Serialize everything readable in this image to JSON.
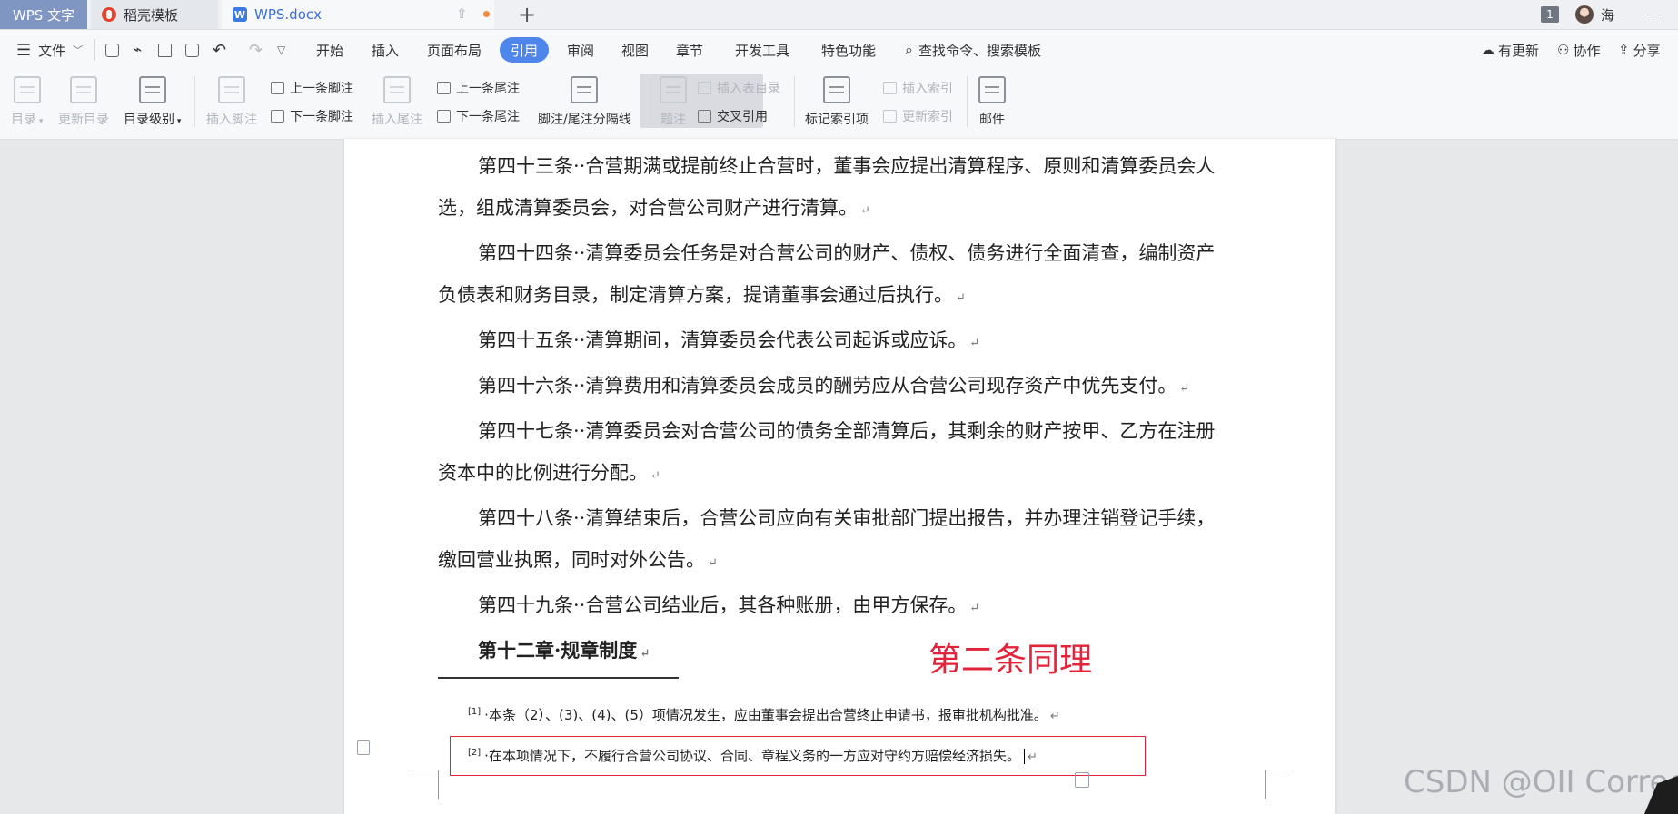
{
  "titlebar": {
    "tabs": [
      {
        "label": "WPS 文字"
      },
      {
        "label": "稻壳模板"
      },
      {
        "label": "WPS.docx"
      }
    ],
    "badge_count": "1",
    "user_name": "海"
  },
  "menubar": {
    "file": "文件",
    "items": [
      "开始",
      "插入",
      "页面布局",
      "引用",
      "审阅",
      "视图",
      "章节",
      "开发工具",
      "特色功能"
    ],
    "active_item": "引用",
    "search": "查找命令、搜索模板",
    "right": [
      "有更新",
      "协作",
      "分享"
    ]
  },
  "ribbon": {
    "toc": "目录",
    "update_toc": "更新目录",
    "toc_level": "目录级别",
    "insert_footnote": "插入脚注",
    "prev_footnote": "上一条脚注",
    "next_footnote": "下一条脚注",
    "insert_endnote": "插入尾注",
    "prev_endnote": "上一条尾注",
    "next_endnote": "下一条尾注",
    "separator": "脚注/尾注分隔线",
    "caption": "题注",
    "insert_table_caption": "插入表目录",
    "cross_ref": "交叉引用",
    "mark_index": "标记索引项",
    "insert_index": "插入索引",
    "update_index": "更新索引",
    "mail": "邮件"
  },
  "document": {
    "paragraphs": [
      {
        "first": "第四十三条··合营期满或提前终止合营时，董事会应提出清算程序、原则和清算委员会人",
        "rest": "选，组成清算委员会，对合营公司财产进行清算。"
      },
      {
        "first": "第四十四条··清算委员会任务是对合营公司的财产、债权、债务进行全面清查，编制资产",
        "rest": "负债表和财务目录，制定清算方案，提请董事会通过后执行。"
      },
      {
        "first": "第四十五条··清算期间，清算委员会代表公司起诉或应诉。",
        "rest": ""
      },
      {
        "first": "第四十六条··清算费用和清算委员会成员的酬劳应从合营公司现存资产中优先支付。",
        "rest": ""
      },
      {
        "first": "第四十七条··清算委员会对合营公司的债务全部清算后，其剩余的财产按甲、乙方在注册",
        "rest": "资本中的比例进行分配。"
      },
      {
        "first": "第四十八条··清算结束后，合营公司应向有关审批部门提出报告，并办理注销登记手续，",
        "rest": "缴回营业执照，同时对外公告。"
      },
      {
        "first": "第四十九条··合营公司结业后，其各种账册，由甲方保存。",
        "rest": ""
      }
    ],
    "chapter": "第十二章·规章制度",
    "annotation": "第二条同理",
    "footnotes": [
      {
        "mark": "[1]",
        "text": "·本条（2）、(3)、(4)、(5）项情况发生，应由董事会提出合营终止申请书，报审批机构批准。"
      },
      {
        "mark": "[2]",
        "text": "·在本项情况下，不履行合营公司协议、合同、章程义务的一方应对守约方赔偿经济损失。"
      }
    ],
    "paragraph_mark": "↵"
  },
  "watermark": "CSDN @OII Correct"
}
